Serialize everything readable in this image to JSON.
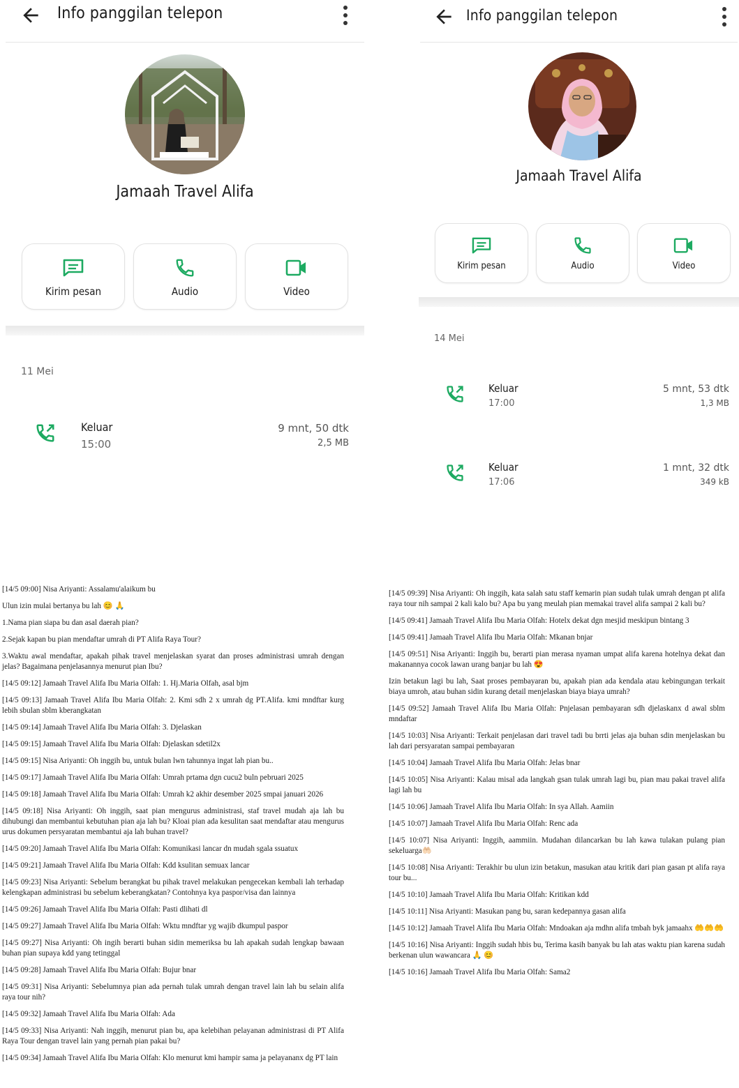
{
  "colors": {
    "accent": "#1daa61",
    "text": "#1a1a1a",
    "muted": "#666666"
  },
  "left_screen": {
    "header": {
      "back_icon": "arrow-left-icon",
      "title": "Info panggilan telepon",
      "menu_icon": "more-vertical-icon"
    },
    "contact": {
      "name": "Jamaah Travel Alifa"
    },
    "actions": [
      {
        "label": "Kirim pesan",
        "icon": "message-icon"
      },
      {
        "label": "Audio",
        "icon": "phone-icon"
      },
      {
        "label": "Video",
        "icon": "video-icon"
      }
    ],
    "date": "11 Mei",
    "calls": [
      {
        "direction": "Keluar",
        "time": "15:00",
        "duration": "9 mnt, 50 dtk",
        "size": "2,5 MB",
        "icon": "outgoing-call-icon"
      }
    ]
  },
  "right_screen": {
    "header": {
      "back_icon": "arrow-left-icon",
      "title": "Info panggilan telepon",
      "menu_icon": "more-vertical-icon"
    },
    "contact": {
      "name": "Jamaah Travel Alifa"
    },
    "actions": [
      {
        "label": "Kirim pesan",
        "icon": "message-icon"
      },
      {
        "label": "Audio",
        "icon": "phone-icon"
      },
      {
        "label": "Video",
        "icon": "video-icon"
      }
    ],
    "date": "14 Mei",
    "calls": [
      {
        "direction": "Keluar",
        "time": "17:00",
        "duration": "5 mnt, 53 dtk",
        "size": "1,3 MB",
        "icon": "outgoing-call-icon"
      },
      {
        "direction": "Keluar",
        "time": "17:06",
        "duration": "1 mnt, 32 dtk",
        "size": "349 kB",
        "icon": "outgoing-call-icon"
      }
    ]
  },
  "transcript_left": [
    "[14/5 09:00] Nisa Ariyanti: Assalamu'alaikum bu",
    "Ulun izin mulai bertanya bu lah 😊 🙏",
    "1.Nama pian siapa bu dan asal daerah pian?",
    "2.Sejak kapan bu pian mendaftar umrah di PT Alifa Raya Tour?",
    "3.Waktu awal mendaftar, apakah pihak travel menjelaskan syarat dan proses administrasi umrah dengan jelas? Bagaimana penjelasannya menurut pian Ibu?",
    "[14/5 09:12] Jamaah Travel Alifa Ibu Maria Olfah: 1. Hj.Maria Olfah, asal bjm",
    "[14/5 09:13] Jamaah Travel Alifa Ibu Maria Olfah: 2. Kmi sdh 2 x umrah dg PT.Alifa. kmi mndftar kurg lebih sbulan sblm kberangkatan",
    "[14/5 09:14] Jamaah Travel Alifa Ibu Maria Olfah: 3. Djelaskan",
    "[14/5 09:15] Jamaah Travel Alifa Ibu Maria Olfah: Djelaskan sdetil2x",
    "[14/5 09:15] Nisa Ariyanti: Oh inggih bu, untuk bulan lwn tahunnya ingat lah pian bu..",
    "[14/5 09:17] Jamaah Travel Alifa Ibu Maria Olfah: Umrah prtama dgn cucu2 buln pebruari 2025",
    "[14/5 09:18] Jamaah Travel Alifa Ibu Maria Olfah: Umrah k2 akhir desember 2025 smpai januari 2026",
    "[14/5 09:18] Nisa Ariyanti: Oh inggih, saat pian mengurus administrasi, staf travel mudah aja lah bu dihubungi dan membantui kebutuhan pian aja lah bu? Kloai pian ada kesulitan saat mendaftar atau mengurus urus dokumen persyaratan membantui aja lah buhan travel?",
    "[14/5 09:20] Jamaah Travel Alifa Ibu Maria Olfah: Komunikasi lancar dn mudah sgala ssuatux",
    "[14/5 09:21] Jamaah Travel Alifa Ibu Maria Olfah: Kdd ksulitan semuax lancar",
    "[14/5 09:23] Nisa Ariyanti: Sebelum berangkat bu pihak travel melakukan pengecekan kembali lah terhadap kelengkapan administrasi bu sebelum keberangkatan? Contohnya kya paspor/visa dan lainnya",
    "[14/5 09:26] Jamaah Travel Alifa Ibu Maria Olfah: Pasti dlihati dl",
    "[14/5 09:27] Jamaah Travel Alifa Ibu Maria Olfah: Wktu mndftar yg wajib dkumpul paspor",
    "[14/5 09:27] Nisa Ariyanti: Oh ingih berarti buhan sidin memeriksa bu lah apakah sudah lengkap bawaan buhan pian supaya kdd yang tetinggal",
    "[14/5 09:28] Jamaah Travel Alifa Ibu Maria Olfah: Bujur bnar",
    "[14/5 09:31] Nisa Ariyanti: Sebelumnya pian ada pernah tulak umrah dengan travel lain lah bu selain alifa raya tour nih?",
    "[14/5 09:32] Jamaah Travel Alifa Ibu Maria Olfah: Ada",
    "[14/5 09:33] Nisa Ariyanti: Nah inggih,  menurut pian bu, apa kelebihan pelayanan administrasi di PT Alifa Raya Tour dengan travel lain yang pernah pian pakai bu?",
    "[14/5 09:34] Jamaah Travel Alifa Ibu Maria Olfah: Klo menurut kmi hampir sama ja pelayananx dg PT lain"
  ],
  "transcript_right": [
    "[14/5 09:39] Nisa Ariyanti: Oh inggih, kata salah satu staff kemarin pian sudah tulak umrah dengan pt alifa raya tour nih sampai 2 kali kalo bu? Apa bu yang meulah pian memakai travel alifa sampai 2 kali bu?",
    "[14/5 09:41] Jamaah Travel Alifa Ibu Maria Olfah: Hotelx dekat dgn mesjid meskipun bintang 3",
    "[14/5 09:41] Jamaah Travel Alifa Ibu Maria Olfah: Mkanan bnjar",
    "[14/5 09:51] Nisa Ariyanti: Inggih bu,  berarti pian merasa nyaman umpat alifa karena hotelnya dekat dan makanannya cocok lawan urang banjar bu lah 😍",
    "Izin betakun lagi bu lah, Saat proses pembayaran bu, apakah pian ada kendala atau kebingungan terkait biaya umroh, atau buhan sidin kurang detail menjelaskan biaya biaya umrah?",
    "[14/5 09:52] Jamaah Travel Alifa Ibu Maria Olfah: Pnjelasan pembayaran sdh djelaskanx d awal sblm mndaftar",
    "[14/5 10:03] Nisa Ariyanti: Terkait penjelasan dari travel tadi bu brrti jelas aja buhan sdin menjelaskan bu lah dari persyaratan sampai pembayaran",
    "[14/5 10:04] Jamaah Travel Alifa Ibu Maria Olfah: Jelas bnar",
    "[14/5 10:05] Nisa Ariyanti: Kalau misal ada langkah gsan tulak umrah lagi bu, pian mau pakai travel alifa lagi lah bu",
    "[14/5 10:06] Jamaah Travel Alifa Ibu Maria Olfah: In sya Allah. Aamiin",
    "[14/5 10:07] Jamaah Travel Alifa Ibu Maria Olfah: Renc ada",
    "[14/5 10:07] Nisa Ariyanti: Inggih, aammiin. Mudahan dilancarkan bu lah kawa tulakan pulang pian sekeluarga🤲🏻",
    "[14/5 10:08] Nisa Ariyanti: Terakhir bu ulun izin betakun, masukan atau kritik dari pian gasan pt alifa raya tour bu...",
    "[14/5 10:10] Jamaah Travel Alifa Ibu Maria Olfah: Kritikan kdd",
    "[14/5 10:11] Nisa Ariyanti: Masukan pang bu, saran kedepannya gasan alifa",
    "[14/5 10:12] Jamaah Travel Alifa Ibu Maria Olfah: Mndoakan aja mdhn alifa tmbah byk jamaahx 🤲🤲🤲",
    "[14/5 10:16] Nisa Ariyanti: Inggih sudah hbis bu, Terima kasih banyak bu lah atas waktu pian karena sudah berkenan ulun wawancara 🙏 😊",
    "[14/5 10:16] Jamaah Travel Alifa Ibu Maria Olfah: Sama2"
  ]
}
